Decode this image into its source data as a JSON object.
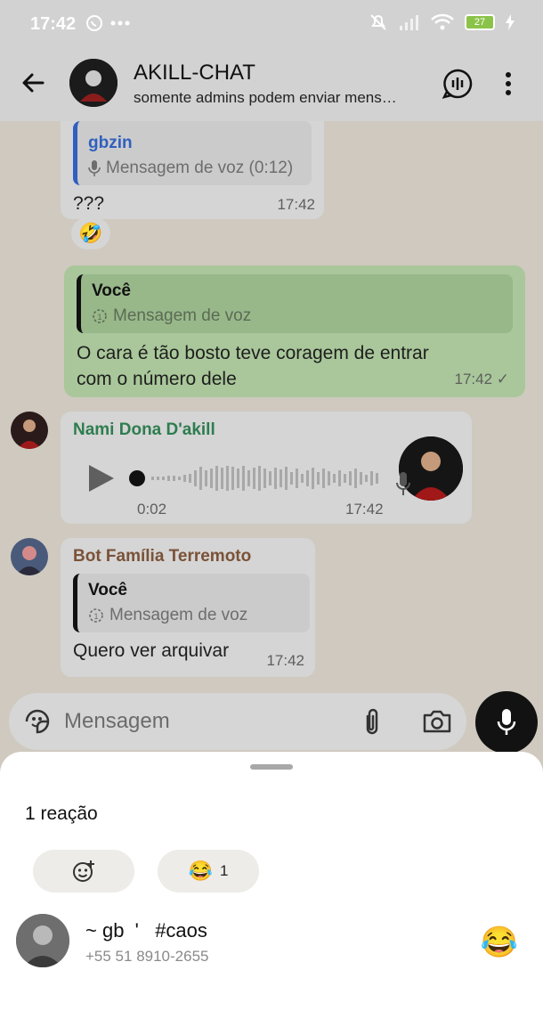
{
  "status_bar": {
    "time": "17:42",
    "battery": "27"
  },
  "header": {
    "title": "AKILL-CHAT",
    "subtitle": "somente admins podem enviar mens…"
  },
  "messages": {
    "m1": {
      "quote_author": "gbzin",
      "quote_body": "Mensagem de voz (0:12)",
      "text": "???",
      "time": "17:42",
      "reaction": "🤣"
    },
    "m2": {
      "quote_author": "Você",
      "quote_body": "Mensagem de voz",
      "text_line1": "O cara é tão bosto teve coragem de entrar",
      "text_line2": "com o número dele",
      "time": "17:42 ✓"
    },
    "m3": {
      "sender": "Nami Dona D'akill",
      "elapsed": "0:02",
      "time": "17:42"
    },
    "m4": {
      "sender": "Bot Família Terremoto",
      "quote_author": "Você",
      "quote_body": "Mensagem de voz",
      "text": "Quero ver arquivar",
      "time": "17:42"
    }
  },
  "composer": {
    "placeholder": "Mensagem"
  },
  "reactions_sheet": {
    "title": "1 reação",
    "pill_count": "1",
    "pill_emoji": "😂",
    "user_name": "~ gb  '   #caos",
    "user_phone": "+55 51 8910-2655",
    "user_emoji": "😂"
  },
  "colors": {
    "out_bubble": "#a9c79a",
    "in_bubble": "#d5d5d5",
    "quote_green_author": "#1f6b3a",
    "nami_name": "#2e7d4f",
    "bot_name": "#7a5238",
    "gbzin_bar": "#2f5fbf"
  },
  "icons": [
    "back-arrow-icon",
    "voice-chat-icon",
    "more-vert-icon",
    "mic-icon",
    "play-icon",
    "sticker-icon",
    "attach-icon",
    "camera-icon",
    "add-reaction-icon",
    "view-once-icon"
  ]
}
